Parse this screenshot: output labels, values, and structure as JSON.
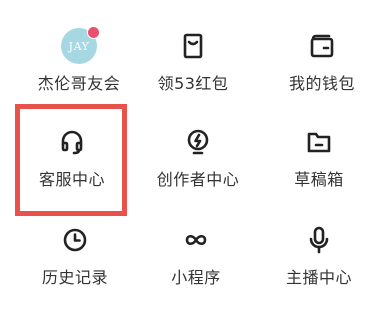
{
  "colors": {
    "icon_stroke": "#222222",
    "avatar_bg": "#a6d8e3",
    "avatar_badge": "#e8506e",
    "highlight_border": "#e8524a"
  },
  "menu": {
    "items": [
      {
        "label": "杰伦哥友会",
        "icon": "jay-avatar-icon",
        "avatar_text": "JAY",
        "has_badge": true
      },
      {
        "label": "领53红包",
        "icon": "red-packet-icon"
      },
      {
        "label": "我的钱包",
        "icon": "wallet-icon"
      },
      {
        "label": "客服中心",
        "icon": "headset-icon",
        "highlighted": true
      },
      {
        "label": "创作者中心",
        "icon": "lightning-bulb-icon"
      },
      {
        "label": "草稿箱",
        "icon": "folder-icon"
      },
      {
        "label": "历史记录",
        "icon": "clock-icon"
      },
      {
        "label": "小程序",
        "icon": "infinity-link-icon"
      },
      {
        "label": "主播中心",
        "icon": "microphone-icon"
      }
    ]
  }
}
